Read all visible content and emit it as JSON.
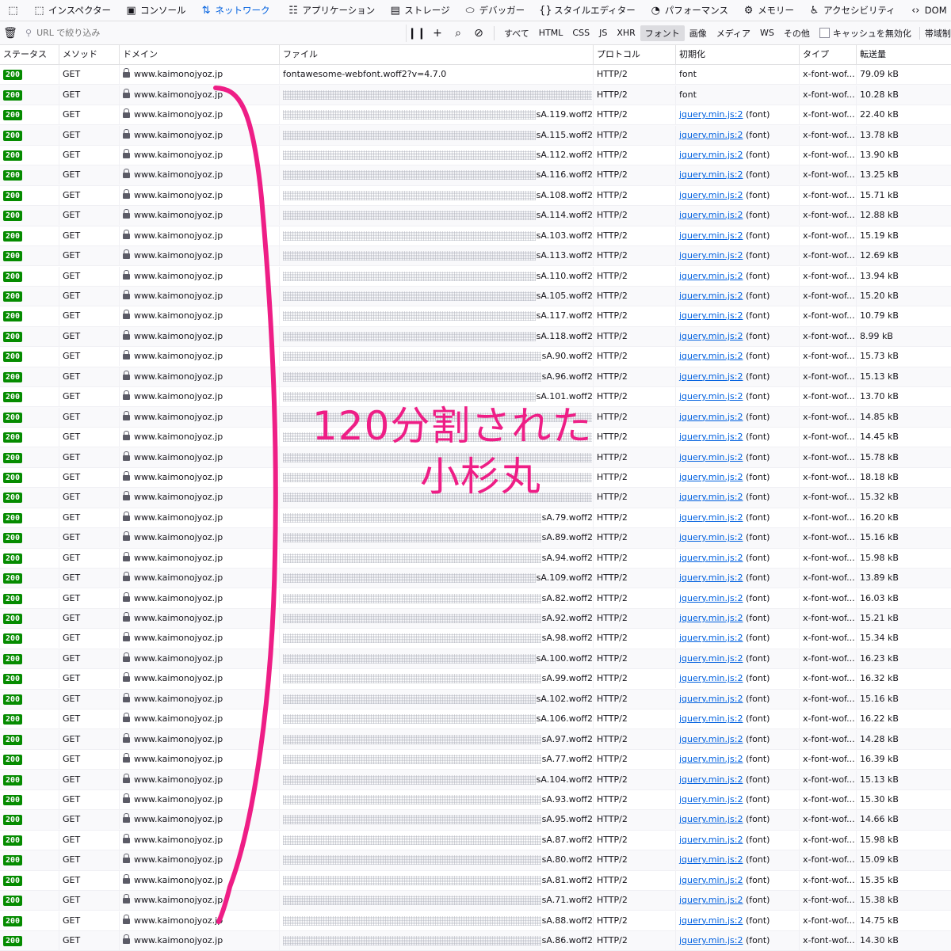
{
  "tabs": [
    {
      "icon": "⬚",
      "label": "インスペクター",
      "name": "inspector"
    },
    {
      "icon": "▣",
      "label": "コンソール",
      "name": "console"
    },
    {
      "icon": "⇅",
      "label": "ネットワーク",
      "name": "network"
    },
    {
      "icon": "☷",
      "label": "アプリケーション",
      "name": "application"
    },
    {
      "icon": "▤",
      "label": "ストレージ",
      "name": "storage"
    },
    {
      "icon": "⬭",
      "label": "デバッガー",
      "name": "debugger"
    },
    {
      "icon": "{}",
      "label": "スタイルエディター",
      "name": "style-editor"
    },
    {
      "icon": "◔",
      "label": "パフォーマンス",
      "name": "performance"
    },
    {
      "icon": "⚙",
      "label": "メモリー",
      "name": "memory"
    },
    {
      "icon": "♿",
      "label": "アクセシビリティ",
      "name": "accessibility"
    },
    {
      "icon": "‹›",
      "label": "DOM",
      "name": "dom"
    }
  ],
  "toolbar": {
    "filter_placeholder": "URL で絞り込み",
    "types": [
      "すべて",
      "HTML",
      "CSS",
      "JS",
      "XHR",
      "フォント",
      "画像",
      "メディア",
      "WS",
      "その他"
    ],
    "active_type": "フォント",
    "cache_label": "キャッシュを無効化",
    "throttle_label": "帯域制"
  },
  "columns": [
    "ステータス",
    "メソッド",
    "ドメイン",
    "ファイル",
    "プロトコル",
    "初期化",
    "タイプ",
    "転送量"
  ],
  "rows": [
    {
      "status": "200",
      "method": "GET",
      "domain": "www.kaimonojyoz.jp",
      "file": "fontawesome-webfont.woff2?v=4.7.0",
      "blurred": false,
      "protocol": "HTTP/2",
      "init": "font",
      "init_link": false,
      "type": "x-font-wof...",
      "size": "79.09 kB"
    },
    {
      "status": "200",
      "method": "GET",
      "domain": "www.kaimonojyoz.jp",
      "file": "",
      "blurred": true,
      "protocol": "HTTP/2",
      "init": "font",
      "init_link": false,
      "type": "x-font-wof...",
      "size": "10.28 kB"
    },
    {
      "status": "200",
      "method": "GET",
      "domain": "www.kaimonojyoz.jp",
      "file": "sA.119.woff2",
      "blurred": true,
      "protocol": "HTTP/2",
      "init": "jquery.min.js:2",
      "init_link": true,
      "type": "x-font-wof...",
      "size": "22.40 kB"
    },
    {
      "status": "200",
      "method": "GET",
      "domain": "www.kaimonojyoz.jp",
      "file": "sA.115.woff2",
      "blurred": true,
      "protocol": "HTTP/2",
      "init": "jquery.min.js:2",
      "init_link": true,
      "type": "x-font-wof...",
      "size": "13.78 kB"
    },
    {
      "status": "200",
      "method": "GET",
      "domain": "www.kaimonojyoz.jp",
      "file": "sA.112.woff2",
      "blurred": true,
      "protocol": "HTTP/2",
      "init": "jquery.min.js:2",
      "init_link": true,
      "type": "x-font-wof...",
      "size": "13.90 kB"
    },
    {
      "status": "200",
      "method": "GET",
      "domain": "www.kaimonojyoz.jp",
      "file": "sA.116.woff2",
      "blurred": true,
      "protocol": "HTTP/2",
      "init": "jquery.min.js:2",
      "init_link": true,
      "type": "x-font-wof...",
      "size": "13.25 kB"
    },
    {
      "status": "200",
      "method": "GET",
      "domain": "www.kaimonojyoz.jp",
      "file": "sA.108.woff2",
      "blurred": true,
      "protocol": "HTTP/2",
      "init": "jquery.min.js:2",
      "init_link": true,
      "type": "x-font-wof...",
      "size": "15.71 kB"
    },
    {
      "status": "200",
      "method": "GET",
      "domain": "www.kaimonojyoz.jp",
      "file": "sA.114.woff2",
      "blurred": true,
      "protocol": "HTTP/2",
      "init": "jquery.min.js:2",
      "init_link": true,
      "type": "x-font-wof...",
      "size": "12.88 kB"
    },
    {
      "status": "200",
      "method": "GET",
      "domain": "www.kaimonojyoz.jp",
      "file": "sA.103.woff2",
      "blurred": true,
      "protocol": "HTTP/2",
      "init": "jquery.min.js:2",
      "init_link": true,
      "type": "x-font-wof...",
      "size": "15.19 kB"
    },
    {
      "status": "200",
      "method": "GET",
      "domain": "www.kaimonojyoz.jp",
      "file": "sA.113.woff2",
      "blurred": true,
      "protocol": "HTTP/2",
      "init": "jquery.min.js:2",
      "init_link": true,
      "type": "x-font-wof...",
      "size": "12.69 kB"
    },
    {
      "status": "200",
      "method": "GET",
      "domain": "www.kaimonojyoz.jp",
      "file": "sA.110.woff2",
      "blurred": true,
      "protocol": "HTTP/2",
      "init": "jquery.min.js:2",
      "init_link": true,
      "type": "x-font-wof...",
      "size": "13.94 kB"
    },
    {
      "status": "200",
      "method": "GET",
      "domain": "www.kaimonojyoz.jp",
      "file": "sA.105.woff2",
      "blurred": true,
      "protocol": "HTTP/2",
      "init": "jquery.min.js:2",
      "init_link": true,
      "type": "x-font-wof...",
      "size": "15.20 kB"
    },
    {
      "status": "200",
      "method": "GET",
      "domain": "www.kaimonojyoz.jp",
      "file": "sA.117.woff2",
      "blurred": true,
      "protocol": "HTTP/2",
      "init": "jquery.min.js:2",
      "init_link": true,
      "type": "x-font-wof...",
      "size": "10.79 kB"
    },
    {
      "status": "200",
      "method": "GET",
      "domain": "www.kaimonojyoz.jp",
      "file": "sA.118.woff2",
      "blurred": true,
      "protocol": "HTTP/2",
      "init": "jquery.min.js:2",
      "init_link": true,
      "type": "x-font-wof...",
      "size": "8.99 kB"
    },
    {
      "status": "200",
      "method": "GET",
      "domain": "www.kaimonojyoz.jp",
      "file": "sA.90.woff2",
      "blurred": true,
      "protocol": "HTTP/2",
      "init": "jquery.min.js:2",
      "init_link": true,
      "type": "x-font-wof...",
      "size": "15.73 kB"
    },
    {
      "status": "200",
      "method": "GET",
      "domain": "www.kaimonojyoz.jp",
      "file": "sA.96.woff2",
      "blurred": true,
      "protocol": "HTTP/2",
      "init": "jquery.min.js:2",
      "init_link": true,
      "type": "x-font-wof...",
      "size": "15.13 kB"
    },
    {
      "status": "200",
      "method": "GET",
      "domain": "www.kaimonojyoz.jp",
      "file": "sA.101.woff2",
      "blurred": true,
      "protocol": "HTTP/2",
      "init": "jquery.min.js:2",
      "init_link": true,
      "type": "x-font-wof...",
      "size": "13.70 kB"
    },
    {
      "status": "200",
      "method": "GET",
      "domain": "www.kaimonojyoz.jp",
      "file": "",
      "blurred": true,
      "protocol": "HTTP/2",
      "init": "jquery.min.js:2",
      "init_link": true,
      "type": "x-font-wof...",
      "size": "14.85 kB"
    },
    {
      "status": "200",
      "method": "GET",
      "domain": "www.kaimonojyoz.jp",
      "file": "",
      "blurred": true,
      "protocol": "HTTP/2",
      "init": "jquery.min.js:2",
      "init_link": true,
      "type": "x-font-wof...",
      "size": "14.45 kB"
    },
    {
      "status": "200",
      "method": "GET",
      "domain": "www.kaimonojyoz.jp",
      "file": "",
      "blurred": true,
      "protocol": "HTTP/2",
      "init": "jquery.min.js:2",
      "init_link": true,
      "type": "x-font-wof...",
      "size": "15.78 kB"
    },
    {
      "status": "200",
      "method": "GET",
      "domain": "www.kaimonojyoz.jp",
      "file": "",
      "blurred": true,
      "protocol": "HTTP/2",
      "init": "jquery.min.js:2",
      "init_link": true,
      "type": "x-font-wof...",
      "size": "18.18 kB"
    },
    {
      "status": "200",
      "method": "GET",
      "domain": "www.kaimonojyoz.jp",
      "file": "",
      "blurred": true,
      "protocol": "HTTP/2",
      "init": "jquery.min.js:2",
      "init_link": true,
      "type": "x-font-wof...",
      "size": "15.32 kB"
    },
    {
      "status": "200",
      "method": "GET",
      "domain": "www.kaimonojyoz.jp",
      "file": "sA.79.woff2",
      "blurred": true,
      "protocol": "HTTP/2",
      "init": "jquery.min.js:2",
      "init_link": true,
      "type": "x-font-wof...",
      "size": "16.20 kB"
    },
    {
      "status": "200",
      "method": "GET",
      "domain": "www.kaimonojyoz.jp",
      "file": "sA.89.woff2",
      "blurred": true,
      "protocol": "HTTP/2",
      "init": "jquery.min.js:2",
      "init_link": true,
      "type": "x-font-wof...",
      "size": "15.16 kB"
    },
    {
      "status": "200",
      "method": "GET",
      "domain": "www.kaimonojyoz.jp",
      "file": "sA.94.woff2",
      "blurred": true,
      "protocol": "HTTP/2",
      "init": "jquery.min.js:2",
      "init_link": true,
      "type": "x-font-wof...",
      "size": "15.98 kB"
    },
    {
      "status": "200",
      "method": "GET",
      "domain": "www.kaimonojyoz.jp",
      "file": "sA.109.woff2",
      "blurred": true,
      "protocol": "HTTP/2",
      "init": "jquery.min.js:2",
      "init_link": true,
      "type": "x-font-wof...",
      "size": "13.89 kB"
    },
    {
      "status": "200",
      "method": "GET",
      "domain": "www.kaimonojyoz.jp",
      "file": "sA.82.woff2",
      "blurred": true,
      "protocol": "HTTP/2",
      "init": "jquery.min.js:2",
      "init_link": true,
      "type": "x-font-wof...",
      "size": "16.03 kB"
    },
    {
      "status": "200",
      "method": "GET",
      "domain": "www.kaimonojyoz.jp",
      "file": "sA.92.woff2",
      "blurred": true,
      "protocol": "HTTP/2",
      "init": "jquery.min.js:2",
      "init_link": true,
      "type": "x-font-wof...",
      "size": "15.21 kB"
    },
    {
      "status": "200",
      "method": "GET",
      "domain": "www.kaimonojyoz.jp",
      "file": "sA.98.woff2",
      "blurred": true,
      "protocol": "HTTP/2",
      "init": "jquery.min.js:2",
      "init_link": true,
      "type": "x-font-wof...",
      "size": "15.34 kB"
    },
    {
      "status": "200",
      "method": "GET",
      "domain": "www.kaimonojyoz.jp",
      "file": "sA.100.woff2",
      "blurred": true,
      "protocol": "HTTP/2",
      "init": "jquery.min.js:2",
      "init_link": true,
      "type": "x-font-wof...",
      "size": "16.23 kB"
    },
    {
      "status": "200",
      "method": "GET",
      "domain": "www.kaimonojyoz.jp",
      "file": "sA.99.woff2",
      "blurred": true,
      "protocol": "HTTP/2",
      "init": "jquery.min.js:2",
      "init_link": true,
      "type": "x-font-wof...",
      "size": "16.32 kB"
    },
    {
      "status": "200",
      "method": "GET",
      "domain": "www.kaimonojyoz.jp",
      "file": "sA.102.woff2",
      "blurred": true,
      "protocol": "HTTP/2",
      "init": "jquery.min.js:2",
      "init_link": true,
      "type": "x-font-wof...",
      "size": "15.16 kB"
    },
    {
      "status": "200",
      "method": "GET",
      "domain": "www.kaimonojyoz.jp",
      "file": "sA.106.woff2",
      "blurred": true,
      "protocol": "HTTP/2",
      "init": "jquery.min.js:2",
      "init_link": true,
      "type": "x-font-wof...",
      "size": "16.22 kB"
    },
    {
      "status": "200",
      "method": "GET",
      "domain": "www.kaimonojyoz.jp",
      "file": "sA.97.woff2",
      "blurred": true,
      "protocol": "HTTP/2",
      "init": "jquery.min.js:2",
      "init_link": true,
      "type": "x-font-wof...",
      "size": "14.28 kB"
    },
    {
      "status": "200",
      "method": "GET",
      "domain": "www.kaimonojyoz.jp",
      "file": "sA.77.woff2",
      "blurred": true,
      "protocol": "HTTP/2",
      "init": "jquery.min.js:2",
      "init_link": true,
      "type": "x-font-wof...",
      "size": "16.39 kB"
    },
    {
      "status": "200",
      "method": "GET",
      "domain": "www.kaimonojyoz.jp",
      "file": "sA.104.woff2",
      "blurred": true,
      "protocol": "HTTP/2",
      "init": "jquery.min.js:2",
      "init_link": true,
      "type": "x-font-wof...",
      "size": "15.13 kB"
    },
    {
      "status": "200",
      "method": "GET",
      "domain": "www.kaimonojyoz.jp",
      "file": "sA.93.woff2",
      "blurred": true,
      "protocol": "HTTP/2",
      "init": "jquery.min.js:2",
      "init_link": true,
      "type": "x-font-wof...",
      "size": "15.30 kB"
    },
    {
      "status": "200",
      "method": "GET",
      "domain": "www.kaimonojyoz.jp",
      "file": "sA.95.woff2",
      "blurred": true,
      "protocol": "HTTP/2",
      "init": "jquery.min.js:2",
      "init_link": true,
      "type": "x-font-wof...",
      "size": "14.66 kB"
    },
    {
      "status": "200",
      "method": "GET",
      "domain": "www.kaimonojyoz.jp",
      "file": "sA.87.woff2",
      "blurred": true,
      "protocol": "HTTP/2",
      "init": "jquery.min.js:2",
      "init_link": true,
      "type": "x-font-wof...",
      "size": "15.98 kB"
    },
    {
      "status": "200",
      "method": "GET",
      "domain": "www.kaimonojyoz.jp",
      "file": "sA.80.woff2",
      "blurred": true,
      "protocol": "HTTP/2",
      "init": "jquery.min.js:2",
      "init_link": true,
      "type": "x-font-wof...",
      "size": "15.09 kB"
    },
    {
      "status": "200",
      "method": "GET",
      "domain": "www.kaimonojyoz.jp",
      "file": "sA.81.woff2",
      "blurred": true,
      "protocol": "HTTP/2",
      "init": "jquery.min.js:2",
      "init_link": true,
      "type": "x-font-wof...",
      "size": "15.35 kB"
    },
    {
      "status": "200",
      "method": "GET",
      "domain": "www.kaimonojyoz.jp",
      "file": "sA.71.woff2",
      "blurred": true,
      "protocol": "HTTP/2",
      "init": "jquery.min.js:2",
      "init_link": true,
      "type": "x-font-wof...",
      "size": "15.38 kB"
    },
    {
      "status": "200",
      "method": "GET",
      "domain": "www.kaimonojyoz.jp",
      "file": "sA.88.woff2",
      "blurred": true,
      "protocol": "HTTP/2",
      "init": "jquery.min.js:2",
      "init_link": true,
      "type": "x-font-wof...",
      "size": "14.75 kB"
    },
    {
      "status": "200",
      "method": "GET",
      "domain": "www.kaimonojyoz.jp",
      "file": "sA.86.woff2",
      "blurred": true,
      "protocol": "HTTP/2",
      "init": "jquery.min.js:2",
      "init_link": true,
      "type": "x-font-wof...",
      "size": "14.30 kB"
    }
  ],
  "annotation": {
    "line1": "120分割された",
    "line2": "小杉丸",
    "color": "#ee1e86"
  },
  "colors": {
    "status_ok": "#058b00",
    "accent": "#0060df"
  }
}
